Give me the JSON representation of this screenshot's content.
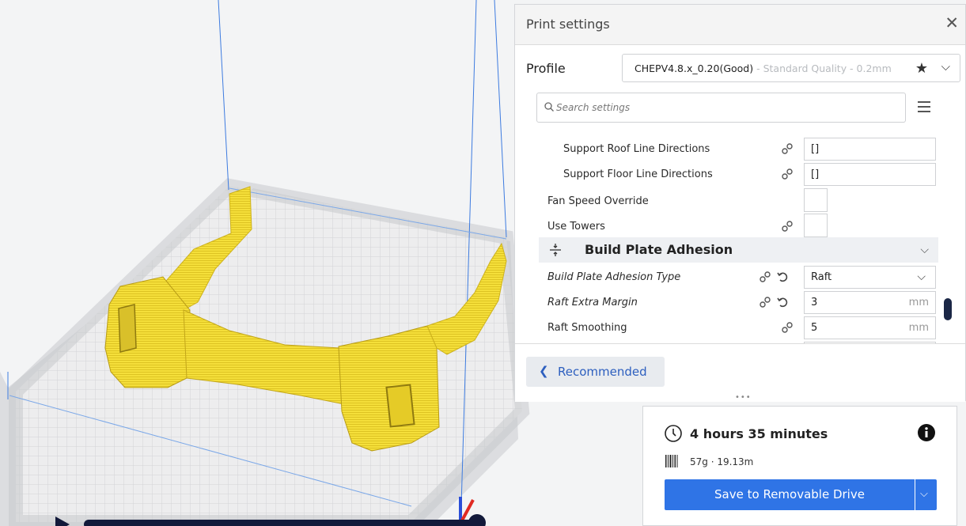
{
  "panel": {
    "title": "Print settings",
    "profile_label": "Profile",
    "profile_name": "CHEPV4.8.x_0.20(Good)",
    "profile_desc": " - Standard Quality - 0.2mm",
    "search_placeholder": "Search settings"
  },
  "settings": {
    "rows": [
      {
        "label": "Support Roof Line Directions",
        "value": "[]"
      },
      {
        "label": "Support Floor Line Directions",
        "value": "[]"
      },
      {
        "label": "Fan Speed Override"
      },
      {
        "label": "Use Towers"
      },
      {
        "label": "Build Plate Adhesion Type",
        "value": "Raft"
      },
      {
        "label": "Raft Extra Margin",
        "value": "3",
        "unit": "mm"
      },
      {
        "label": "Raft Smoothing",
        "value": "5",
        "unit": "mm"
      }
    ],
    "category": "Build Plate Adhesion"
  },
  "footer": {
    "recommended_label": "Recommended",
    "resize_dots": "•••"
  },
  "output": {
    "time": "4 hours 35 minutes",
    "material": "57g · 19.13m",
    "save_label": "Save to Removable Drive"
  },
  "colors": {
    "accent": "#2f74e6",
    "model": "#f7e23a",
    "dark": "#12193a"
  }
}
